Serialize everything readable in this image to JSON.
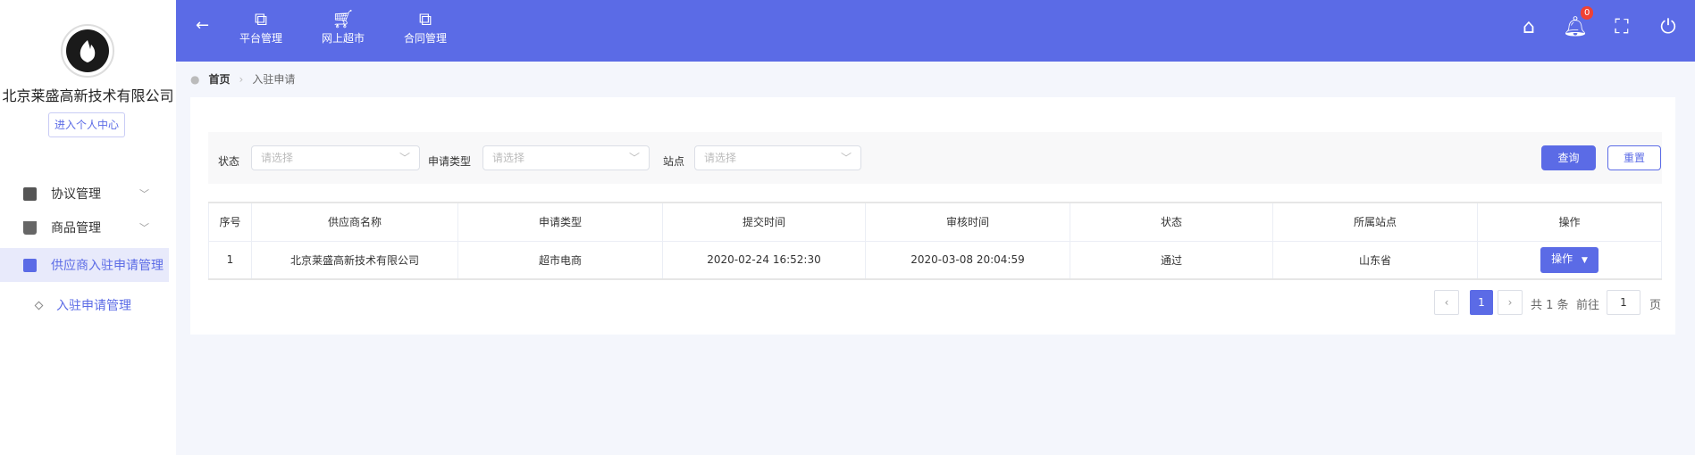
{
  "sidebar": {
    "company": "北京莱盛高新技术有限公司",
    "center_button": "进入个人中心",
    "items": [
      {
        "label": "协议管理"
      },
      {
        "label": "商品管理"
      },
      {
        "label": "供应商入驻申请管理"
      }
    ],
    "sub_item": "入驻申请管理"
  },
  "header": {
    "nav": [
      {
        "label": "平台管理",
        "icon": "org-chart-icon"
      },
      {
        "label": "网上超市",
        "icon": "cart-icon"
      },
      {
        "label": "合同管理",
        "icon": "org-chart-icon"
      }
    ],
    "badge": "0"
  },
  "breadcrumb": {
    "home": "首页",
    "current": "入驻申请"
  },
  "filter": {
    "status_label": "状态",
    "type_label": "申请类型",
    "site_label": "站点",
    "placeholder": "请选择",
    "query": "查询",
    "reset": "重置"
  },
  "table": {
    "headers": [
      "序号",
      "供应商名称",
      "申请类型",
      "提交时间",
      "审核时间",
      "状态",
      "所属站点",
      "操作"
    ],
    "rows": [
      [
        "1",
        "北京莱盛高新技术有限公司",
        "超市电商",
        "2020-02-24 16:52:30",
        "2020-03-08 20:04:59",
        "通过",
        "山东省",
        "操作"
      ]
    ]
  },
  "pagination": {
    "current": "1",
    "total": "共 1 条",
    "goto": "前往",
    "goto_value": "1",
    "page_suffix": "页"
  },
  "colors": {
    "primary": "#5b6be6"
  }
}
